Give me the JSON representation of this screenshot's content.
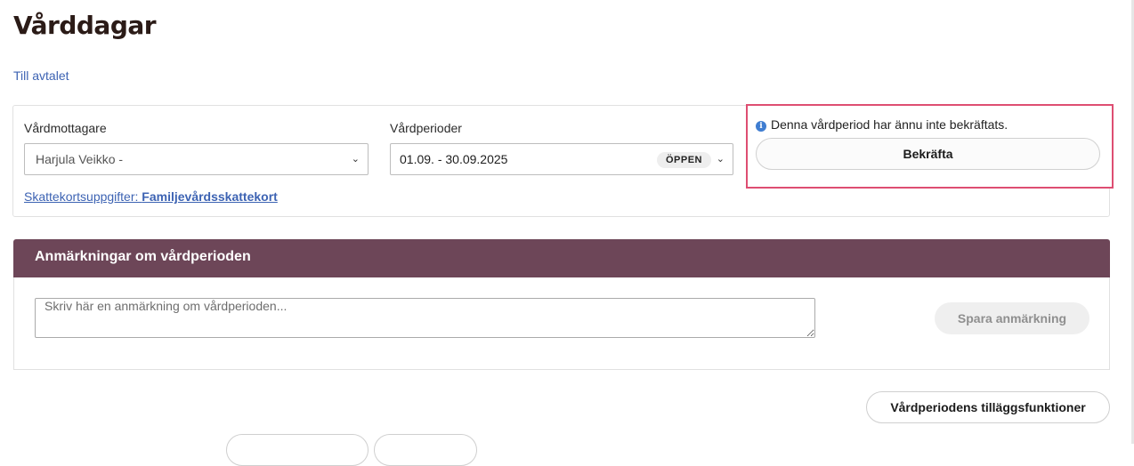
{
  "page": {
    "title": "Vårddagar",
    "back_link": "Till avtalet"
  },
  "recipient": {
    "label": "Vårdmottagare",
    "selected": "Harjula Veikko -"
  },
  "period": {
    "label": "Vårdperioder",
    "selected": "01.09. - 30.09.2025",
    "status": "ÖPPEN"
  },
  "tax": {
    "prefix": "Skattekortsuppgifter: ",
    "value": "Familjevårdsskattekort"
  },
  "confirmation": {
    "message": "Denna vårdperiod har ännu inte bekräftats.",
    "button": "Bekräfta",
    "highlight_color": "#de4e72"
  },
  "notes": {
    "title": "Anmärkningar om vårdperioden",
    "placeholder": "Skriv här en anmärkning om vårdperioden...",
    "save_button": "Spara anmärkning",
    "header_color": "#6d4658"
  },
  "extras": {
    "button": "Vårdperiodens tilläggsfunktioner"
  },
  "icons": {
    "info": "info-icon",
    "dropdown": "chevron-down-icon"
  }
}
